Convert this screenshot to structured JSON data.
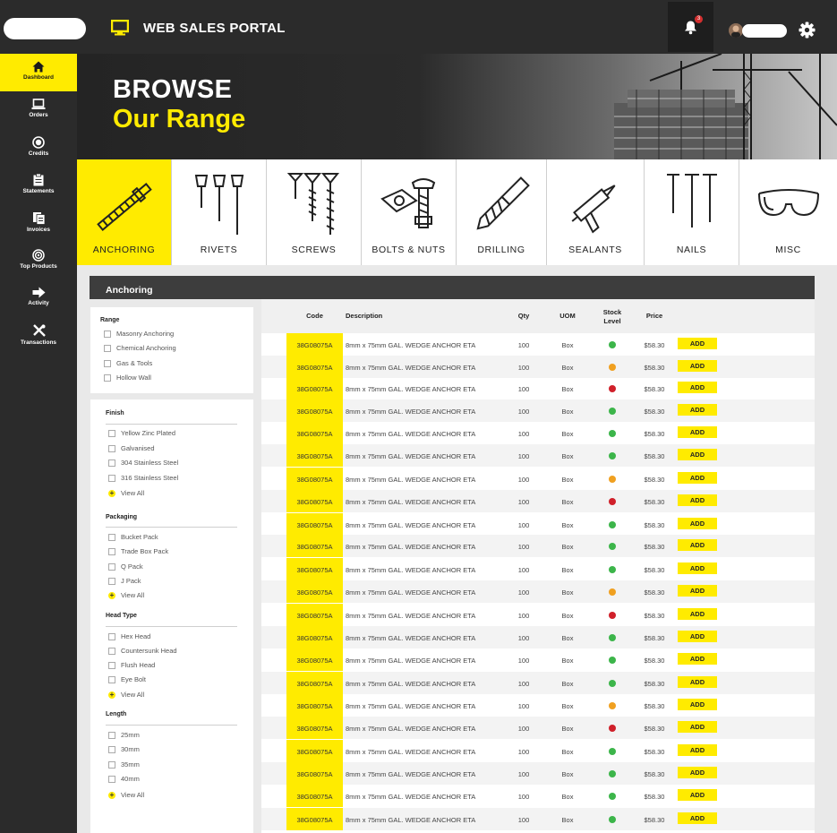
{
  "header": {
    "title": "WEB SALES PORTAL",
    "notification_count": "3"
  },
  "sidebar": {
    "items": [
      {
        "label": "Dashboard",
        "icon": "home-icon",
        "active": true
      },
      {
        "label": "Orders",
        "icon": "laptop-icon"
      },
      {
        "label": "Credits",
        "icon": "coin-icon"
      },
      {
        "label": "Statements",
        "icon": "clipboard-icon"
      },
      {
        "label": "Invoices",
        "icon": "documents-icon"
      },
      {
        "label": "Top Products",
        "icon": "target-icon"
      },
      {
        "label": "Activity",
        "icon": "arrow-right-icon"
      },
      {
        "label": "Transactions",
        "icon": "tools-icon"
      }
    ]
  },
  "hero": {
    "title": "BROWSE",
    "subtitle": "Our Range"
  },
  "categories": [
    {
      "label": "ANCHORING",
      "active": true
    },
    {
      "label": "RIVETS"
    },
    {
      "label": "SCREWS"
    },
    {
      "label": "BOLTS & NUTS"
    },
    {
      "label": "DRILLING"
    },
    {
      "label": "SEALANTS"
    },
    {
      "label": "NAILS"
    },
    {
      "label": "MISC"
    }
  ],
  "panel": {
    "title": "Anchoring"
  },
  "filters": {
    "range": {
      "title": "Range",
      "options": [
        "Masonry Anchoring",
        "Chemical Anchoring",
        "Gas & Tools",
        "Hollow Wall"
      ]
    },
    "finish": {
      "title": "Finish",
      "options": [
        "Yellow Zinc Plated",
        "Galvanised",
        "304 Stainless Steel",
        "316 Stainless Steel"
      ],
      "view_all": "View All"
    },
    "packaging": {
      "title": "Packaging",
      "options": [
        "Bucket Pack",
        "Trade Box Pack",
        "Q Pack",
        "J Pack"
      ],
      "view_all": "View All"
    },
    "head_type": {
      "title": "Head Type",
      "options": [
        "Hex Head",
        "Countersunk Head",
        "Flush Head",
        "Eye Bolt"
      ],
      "view_all": "View All"
    },
    "length": {
      "title": "Length",
      "options": [
        "25mm",
        "30mm",
        "35mm",
        "40mm"
      ],
      "view_all": "View All"
    }
  },
  "table": {
    "columns": {
      "code": "Code",
      "description": "Description",
      "qty": "Qty",
      "uom": "UOM",
      "stock_1": "Stock",
      "stock_2": "Level",
      "price": "Price"
    },
    "add_label": "ADD",
    "stock_colors": {
      "green": "#3cb54a",
      "orange": "#f0a020",
      "red": "#d0202a"
    },
    "rows": [
      {
        "code": "38G08075A",
        "description": "8mm x 75mm GAL. WEDGE ANCHOR ETA",
        "qty": "100",
        "uom": "Box",
        "stock": "green",
        "price": "$58.30"
      },
      {
        "code": "38G08075A",
        "description": "8mm x 75mm GAL. WEDGE ANCHOR ETA",
        "qty": "100",
        "uom": "Box",
        "stock": "orange",
        "price": "$58.30"
      },
      {
        "code": "38G08075A",
        "description": "8mm x 75mm GAL. WEDGE ANCHOR ETA",
        "qty": "100",
        "uom": "Box",
        "stock": "red",
        "price": "$58.30"
      },
      {
        "code": "38G08075A",
        "description": "8mm x 75mm GAL. WEDGE ANCHOR ETA",
        "qty": "100",
        "uom": "Box",
        "stock": "green",
        "price": "$58.30"
      },
      {
        "code": "38G08075A",
        "description": "8mm x 75mm GAL. WEDGE ANCHOR ETA",
        "qty": "100",
        "uom": "Box",
        "stock": "green",
        "price": "$58.30"
      },
      {
        "code": "38G08075A",
        "description": "8mm x 75mm GAL. WEDGE ANCHOR ETA",
        "qty": "100",
        "uom": "Box",
        "stock": "green",
        "price": "$58.30"
      },
      {
        "code": "38G08075A",
        "description": "8mm x 75mm GAL. WEDGE ANCHOR ETA",
        "qty": "100",
        "uom": "Box",
        "stock": "orange",
        "price": "$58.30"
      },
      {
        "code": "38G08075A",
        "description": "8mm x 75mm GAL. WEDGE ANCHOR ETA",
        "qty": "100",
        "uom": "Box",
        "stock": "red",
        "price": "$58.30"
      },
      {
        "code": "38G08075A",
        "description": "8mm x 75mm GAL. WEDGE ANCHOR ETA",
        "qty": "100",
        "uom": "Box",
        "stock": "green",
        "price": "$58.30"
      },
      {
        "code": "38G08075A",
        "description": "8mm x 75mm GAL. WEDGE ANCHOR ETA",
        "qty": "100",
        "uom": "Box",
        "stock": "green",
        "price": "$58.30"
      },
      {
        "code": "38G08075A",
        "description": "8mm x 75mm GAL. WEDGE ANCHOR ETA",
        "qty": "100",
        "uom": "Box",
        "stock": "green",
        "price": "$58.30"
      },
      {
        "code": "38G08075A",
        "description": "8mm x 75mm GAL. WEDGE ANCHOR ETA",
        "qty": "100",
        "uom": "Box",
        "stock": "orange",
        "price": "$58.30"
      },
      {
        "code": "38G08075A",
        "description": "8mm x 75mm GAL. WEDGE ANCHOR ETA",
        "qty": "100",
        "uom": "Box",
        "stock": "red",
        "price": "$58.30"
      },
      {
        "code": "38G08075A",
        "description": "8mm x 75mm GAL. WEDGE ANCHOR ETA",
        "qty": "100",
        "uom": "Box",
        "stock": "green",
        "price": "$58.30"
      },
      {
        "code": "38G08075A",
        "description": "8mm x 75mm GAL. WEDGE ANCHOR ETA",
        "qty": "100",
        "uom": "Box",
        "stock": "green",
        "price": "$58.30"
      },
      {
        "code": "38G08075A",
        "description": "8mm x 75mm GAL. WEDGE ANCHOR ETA",
        "qty": "100",
        "uom": "Box",
        "stock": "green",
        "price": "$58.30"
      },
      {
        "code": "38G08075A",
        "description": "8mm x 75mm GAL. WEDGE ANCHOR ETA",
        "qty": "100",
        "uom": "Box",
        "stock": "orange",
        "price": "$58.30"
      },
      {
        "code": "38G08075A",
        "description": "8mm x 75mm GAL. WEDGE ANCHOR ETA",
        "qty": "100",
        "uom": "Box",
        "stock": "red",
        "price": "$58.30"
      },
      {
        "code": "38G08075A",
        "description": "8mm x 75mm GAL. WEDGE ANCHOR ETA",
        "qty": "100",
        "uom": "Box",
        "stock": "green",
        "price": "$58.30"
      },
      {
        "code": "38G08075A",
        "description": "8mm x 75mm GAL. WEDGE ANCHOR ETA",
        "qty": "100",
        "uom": "Box",
        "stock": "green",
        "price": "$58.30"
      },
      {
        "code": "38G08075A",
        "description": "8mm x 75mm GAL. WEDGE ANCHOR ETA",
        "qty": "100",
        "uom": "Box",
        "stock": "green",
        "price": "$58.30"
      },
      {
        "code": "38G08075A",
        "description": "8mm x 75mm GAL. WEDGE ANCHOR ETA",
        "qty": "100",
        "uom": "Box",
        "stock": "green",
        "price": "$58.30"
      }
    ]
  }
}
